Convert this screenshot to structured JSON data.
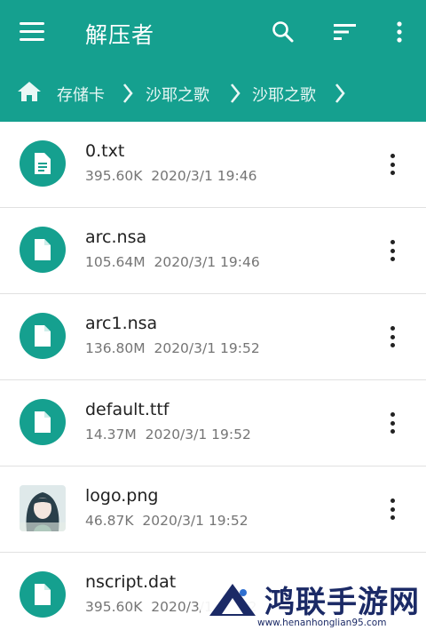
{
  "app": {
    "title": "解压者",
    "icons": [
      "menu-icon",
      "search-icon",
      "sort-icon",
      "more-vert-icon"
    ],
    "accent_color": "#15a08f"
  },
  "breadcrumb": {
    "home_icon": "home-icon",
    "items": [
      "存储卡",
      "沙耶之歌",
      "沙耶之歌"
    ]
  },
  "files": [
    {
      "name": "0.txt",
      "size": "395.60K",
      "date": "2020/3/1 19:46",
      "icon": "text-file-icon"
    },
    {
      "name": "arc.nsa",
      "size": "105.64M",
      "date": "2020/3/1 19:46",
      "icon": "file-icon"
    },
    {
      "name": "arc1.nsa",
      "size": "136.80M",
      "date": "2020/3/1 19:52",
      "icon": "file-icon"
    },
    {
      "name": "default.ttf",
      "size": "14.37M",
      "date": "2020/3/1 19:52",
      "icon": "file-icon"
    },
    {
      "name": "logo.png",
      "size": "46.87K",
      "date": "2020/3/1 19:52",
      "icon": "image-thumbnail"
    },
    {
      "name": "nscript.dat",
      "size": "395.60K",
      "date": "2020/3/1 19:52",
      "icon": "file-icon"
    }
  ],
  "watermark": {
    "text": "鸿联手游网",
    "url": "www.henanhonglian95.com"
  }
}
